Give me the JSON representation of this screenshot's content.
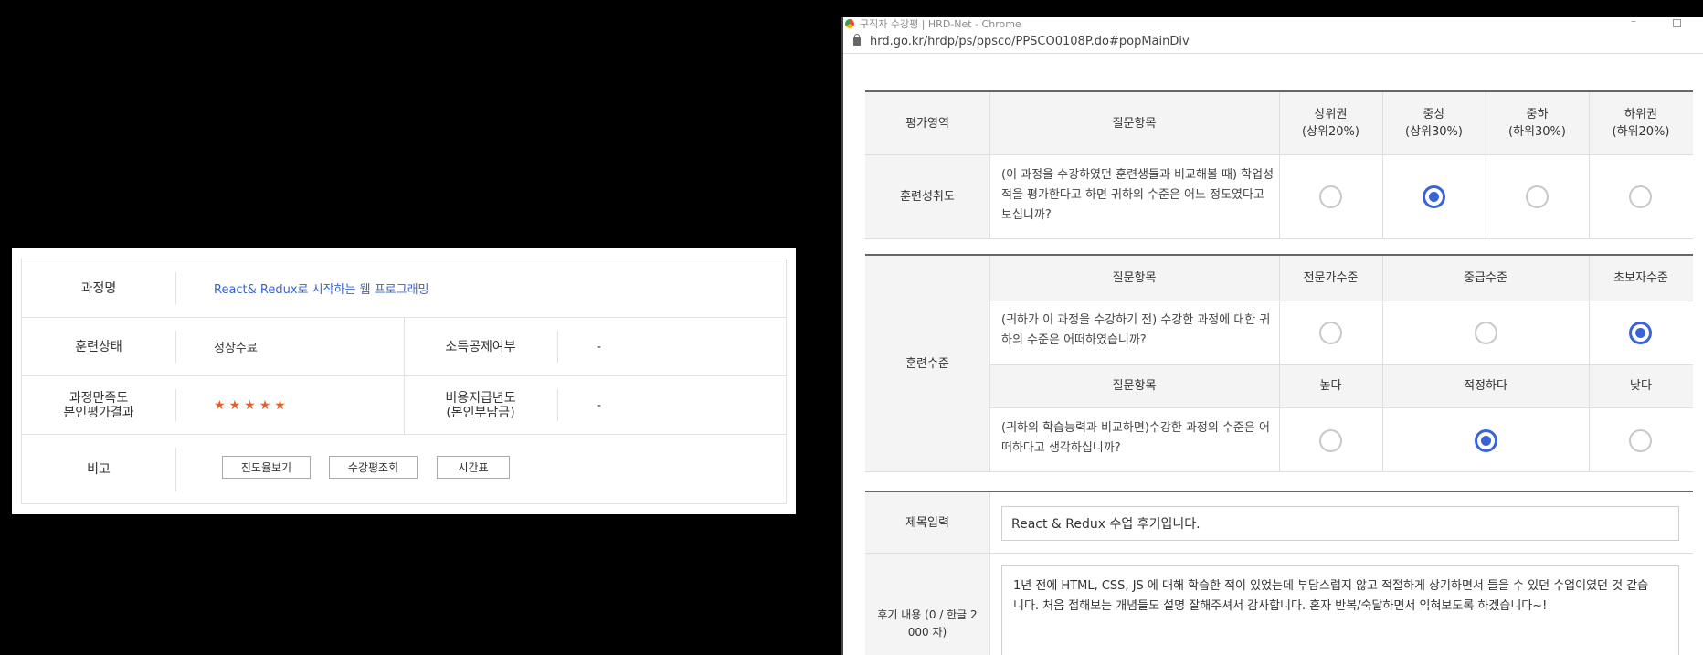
{
  "left": {
    "rows": [
      {
        "label": "과정명",
        "value": "React& Redux로 시작하는 웹 프로그래밍"
      },
      {
        "label": "훈련상태",
        "value": "정상수료",
        "label2": "소득공제여부",
        "value2": "-"
      },
      {
        "label": "과정만족도\n본인평가결과",
        "rating": 5,
        "label2": "비용지급년도\n(본인부담금)",
        "value2": "-"
      },
      {
        "label": "비고"
      }
    ],
    "stars": [
      "★",
      "★",
      "★",
      "★",
      "★"
    ],
    "buttons": [
      "진도율보기",
      "수강평조회",
      "시간표"
    ]
  },
  "window": {
    "title": "구직자 수강평 | HRD-Net - Chrome",
    "min_glyph": "–",
    "url": "hrd.go.kr/hrdp/ps/ppsco/PPSCO0108P.do#popMainDiv"
  },
  "table1": {
    "headers": [
      "평가영역",
      "질문항목",
      "상위권\n(상위20%)",
      "중상\n(상위30%)",
      "중하\n(하위30%)",
      "하위권\n(하위20%)"
    ],
    "area": "훈련성취도",
    "question": "(이 과정을 수강하였던 훈련생들과 비교해볼 때) 학업성\n적을 평가한다고 하면 귀하의 수준은 어느 정도였다고\n보십니까?",
    "selected_index": 1
  },
  "table2": {
    "area": "훈련수준",
    "q1_headers": [
      "질문항목",
      "전문가수준",
      "중급수준",
      "초보자수준"
    ],
    "q1_text": "(귀하가 이 과정을 수강하기 전) 수강한 과정에 대한 귀\n하의 수준은 어떠하였습니까?",
    "q1_selected_index": 2,
    "q2_headers": [
      "질문항목",
      "높다",
      "적정하다",
      "낮다"
    ],
    "q2_text": "(귀하의 학습능력과 비교하면)수강한 과정의 수준은 어\n떠하다고 생각하십니까?",
    "q2_selected_index": 1
  },
  "review": {
    "title_label": "제목입력",
    "title_value": "React & Redux 수업 후기입니다.",
    "content_label": "후기 내용 (0 / 한글 2\n000 자)",
    "content_value": "1년 전에 HTML, CSS, JS 에 대해 학습한 적이 있었는데 부담스럽지 않고 적절하게 상기하면서 들을 수 있던 수업이였던 것 같습\n니다. 처음 접해보는 개념들도 설명 잘해주셔서 감사합니다. 혼자 반복/숙달하면서 익혀보도록 하겠습니다~!"
  },
  "colors": {
    "accent": "#3a63d6",
    "link": "#3a64c8",
    "star": "#e0622a"
  }
}
